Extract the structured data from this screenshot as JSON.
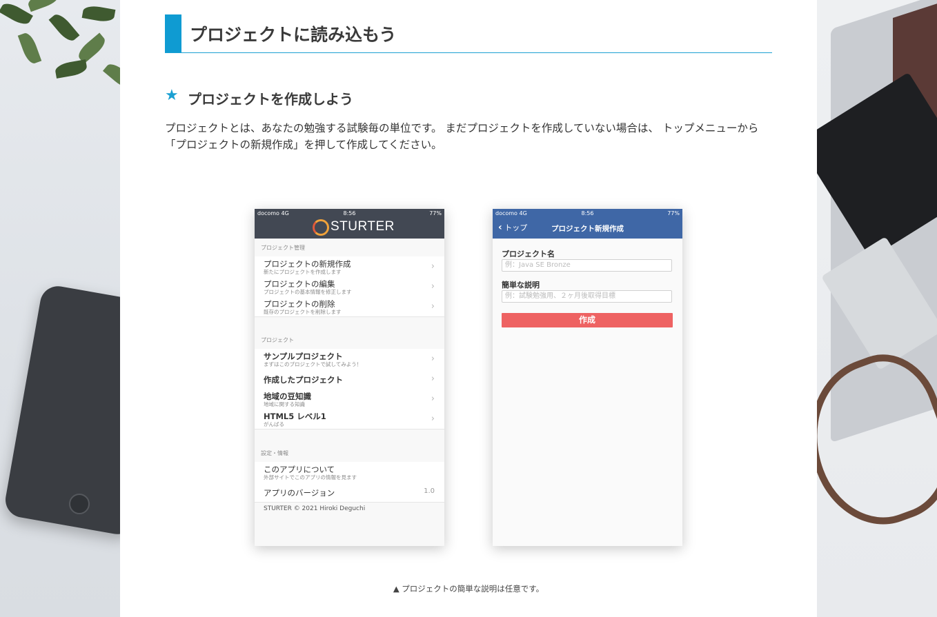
{
  "section_heading": "プロジェクトに読み込もう",
  "subheading": "プロジェクトを作成しよう",
  "description": "プロジェクトとは、あなたの勉強する試験毎の単位です。 まだプロジェクトを作成していない場合は、 トップメニューから「プロジェクトの新規作成」を押して作成してください。",
  "caption": "▲ プロジェクトの簡単な説明は任意です。",
  "colors": {
    "accent": "#0f9bd2",
    "menu_header": "#424853",
    "form_header": "#3f67a6",
    "create_button": "#ee6262"
  },
  "screen1": {
    "status": {
      "carrier": "docomo 4G",
      "time": "8:56",
      "battery": "77%"
    },
    "app_name": "STURTER",
    "sections": [
      {
        "label": "プロジェクト管理",
        "items": [
          {
            "title": "プロジェクトの新規作成",
            "subtitle": "新たにプロジェクトを作成します"
          },
          {
            "title": "プロジェクトの編集",
            "subtitle": "プロジェクトの基本情報を修正します"
          },
          {
            "title": "プロジェクトの削除",
            "subtitle": "既存のプロジェクトを削除します"
          }
        ]
      },
      {
        "label": "プロジェクト",
        "items": [
          {
            "title": "サンプルプロジェクト",
            "subtitle": "まずはこのプロジェクトで試してみよう！"
          },
          {
            "title": "作成したプロジェクト",
            "subtitle": ""
          },
          {
            "title": "地域の豆知識",
            "subtitle": "地域に関する知識"
          },
          {
            "title": "HTML5 レベル1",
            "subtitle": "がんばる"
          }
        ]
      },
      {
        "label": "設定・情報",
        "items": [
          {
            "title": "このアプリについて",
            "subtitle": "外部サイトでこのアプリの情報を見ます"
          },
          {
            "title": "アプリのバージョン",
            "value": "1.0"
          }
        ]
      }
    ],
    "copyright": "STURTER  © 2021 Hiroki Deguchi"
  },
  "screen2": {
    "status": {
      "carrier": "docomo 4G",
      "time": "8:56",
      "battery": "77%"
    },
    "back_label": "トップ",
    "title": "プロジェクト新規作成",
    "name_label": "プロジェクト名",
    "name_placeholder": "例：Java SE Bronze",
    "desc_label": "簡単な説明",
    "desc_placeholder": "例：試験勉強用、２ヶ月後取得目標",
    "create_label": "作成"
  }
}
